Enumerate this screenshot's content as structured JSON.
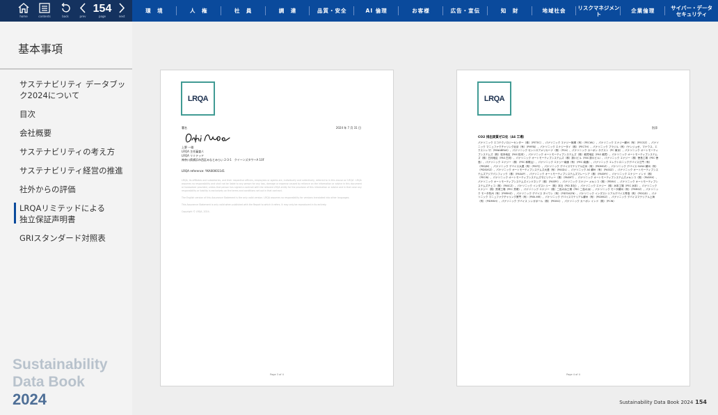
{
  "toolbar": {
    "home_label": "home",
    "contents_label": "contents",
    "back_label": "back",
    "prev_label": "prev",
    "page_label": "page",
    "next_label": "next",
    "page_number": "154"
  },
  "nav": {
    "items": [
      "環　境",
      "人　権",
      "社　員",
      "調　達",
      "品質・安全",
      "AI 倫理",
      "お客様",
      "広告・宣伝",
      "知　財",
      "地域社会",
      "リスクマネジメント",
      "企業倫理",
      "サイバー・データセキュリティ"
    ]
  },
  "sidebar": {
    "title": "基本事項",
    "items": [
      {
        "label": "サステナビリティ データブック2024について",
        "active": false
      },
      {
        "label": "目次",
        "active": false
      },
      {
        "label": "会社概要",
        "active": false
      },
      {
        "label": "サステナビリティの考え方",
        "active": false
      },
      {
        "label": "サステナビリティ経営の推進",
        "active": false
      },
      {
        "label": "社外からの評価",
        "active": false
      },
      {
        "label": "LRQAリミテッドによる独立保証声明書",
        "active": true
      },
      {
        "label": "GRIスタンダード対照表",
        "active": false
      }
    ],
    "brand_line1": "Sustainability",
    "brand_line2": "Data Book",
    "brand_year": "2024"
  },
  "left_page": {
    "logo": "LRQA",
    "sign_label": "署名",
    "date": "2024 年 7 月 31 日",
    "signer_name": "上野 一雄",
    "signer_org": "LRQA 主任審査人",
    "signer_company": "LRQA リミテッド",
    "signer_address": "神奈川県横浜市西区みなとみらい 2-3-1　クイーンズタワーA 10F",
    "reference": "LRQA reference: YKA00001141",
    "legal_1": "LRQA, its affiliates and subsidiaries, and their respective officers, employees or agents are, individually and collectively, referred to in this clause as 'LRQA'. LRQA assumes no responsibility and shall not be liable to any person for any loss, damage or expense caused by reliance on the information or advice in this document or howsoever provided, unless that person has signed a contract with the relevant LRQA entity for the provision of this information or advice and in that case any responsibility or liability is exclusively on the terms and conditions set out in that contract.",
    "legal_2": "The English version of this Assurance Statement is the only valid version. LRQA assumes no responsibility for versions translated into other languages.",
    "legal_3": "This Assurance Statement is only valid when published with the Report to which it refers. It may only be reproduced in its entirety.",
    "legal_4": "Copyright © LRQA, 2024.",
    "footer": "Page 3 of 4"
  },
  "right_page": {
    "logo": "LRQA",
    "annex": "別添",
    "heading": "CO2 排出実質ゼロ化（44 工場）",
    "body": "パナソニック エコテクノロジーセンター（株）（PETEC）、パナソニック エナジー無錫（有）（PECWL）、パナソニック エナジー蘇州（有）（PECSZ）、パナソニック マニュファクチャリング北京（有）（PMFBJ）、パナソニック エナジータイ（株）（PECTH）、パナソニック ブラジル（有）（サンジョゼ、マナウス、エクストレマ）（PANABRAS）、パナソニック セントロアメリカーナ（株）（PCA）、パナソニック カーボン ネクスト（PC 東京）、パナソニック オートモーティブシステムズ（株）松本地区（PAS 松本）、パナソニック オートモーティブシステムズ（株）敦賀地区（PAS 敦賀）、パナソニック オートモーティブシステムズ（株）白河地区（PAS 白河）、パナソニック オートモーティブシステムズ（株）掛川ビル（PAS 掛川ビル）、パナソニック エナジー（株）徳島工場（PEC 徳島）、パナソニック エナジー（株）（PEC 和歌山）、パナソニック エナジー南通（有）（PEC 南通）、パナソニック エレクトロニックデバイス江門（有）（PEDJM）、パナソニック デバイス大連（有）（PIDTJ）、パナソニック デバイスマテリアル広州（有）（PIDMGZ）、パナソニック デバイス SUNX 蘇州（有）（PIDSXSZ）、パナソニック オートモーティブシステムズ大連（有）（PASDL）、パナソニック AS 蘇州（有）（PASSZ）、パナソニック オートモーティブシステムズアジアパシフィック（株）（PASAP）、パナソニック オートモーティブシステムズマレーシア（株）（PASMY）、パナソニック エナジー インド（株）（PECIN）、パナソニック オートモーティブシステムズモビリティー（株）（PASMT）、パナソニック オートモーティブシステムズメキシコ（株）（PASMX）、パナソニック オートモーティブシステムズインドネシア（株）（PASRY）、パナソニック エナジー メキシコ（株）（PEMX）、パナソニック オートモーティブシステムズチェコ（株）（PASCZ）、パナソニック インダストリー（株）本社（PID 本社）、パナソニック エナジー（株）洲本工場（PEC 洲本）、パナソニック エナジー（株）貝塚工場（PEC 貝塚）、パナソニック エナジー（株）二色の浜工場（PEC 二色の浜）、パナソニック モータ蘇州（有）（PMRSZ）、パナソニック モータ杭州（有）（PMRHZ）、パナソニック デバイス タイワン（有）（PIDTASZN）、パナソニック インダストリアルデバイス青島（有）（PIDQD）、パナソニック マニュファクチャリング厦門（有）（PMX-MR）、パナソニック デバイスマテリアル蘇州（有）（PIDMSZ）、パナソニック デバイスマテリアル上海（有）（PIDMSH）、パナソニック デバイス シンガポール（株）（PIDSG）、パナソニック カーボン インド（株）（PCIN）",
    "footer": "Page 4 of 4"
  },
  "footer": {
    "title": "Sustainability Data Book 2024",
    "page": "154"
  }
}
